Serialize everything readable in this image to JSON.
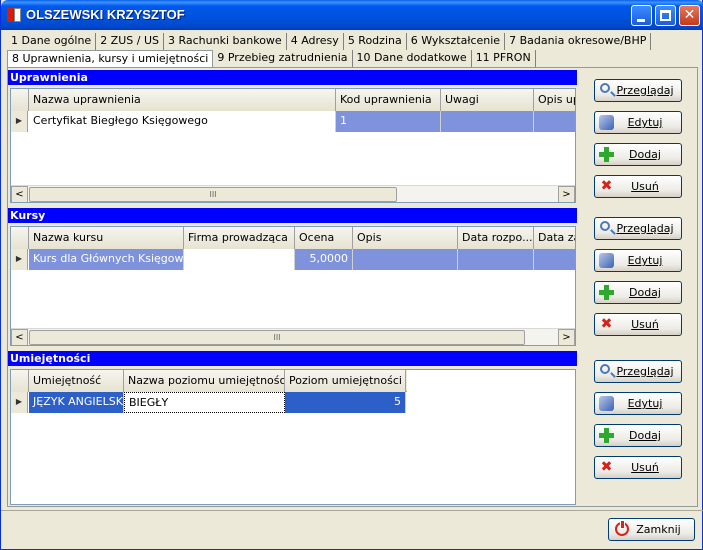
{
  "window": {
    "title": "OLSZEWSKI KRZYSZTOF"
  },
  "tabs_row1": [
    "1 Dane ogólne",
    "2 ZUS / US",
    "3 Rachunki bankowe",
    "4 Adresy",
    "5 Rodzina",
    "6 Wykształcenie",
    "7 Badania okresowe/BHP"
  ],
  "tabs_row2": [
    "8 Uprawnienia, kursy i umiejętności",
    "9 Przebieg zatrudnienia",
    "10 Dane dodatkowe",
    "11 PFRON"
  ],
  "uprawnienia": {
    "header": "Uprawnienia",
    "columns": [
      "Nazwa uprawnienia",
      "Kod uprawnienia",
      "Uwagi",
      "Opis up"
    ],
    "rows": [
      [
        "Certyfikat Biegłego Księgowego",
        "1",
        "",
        ""
      ]
    ]
  },
  "kursy": {
    "header": "Kursy",
    "columns": [
      "Nazwa kursu",
      "Firma prowadząca",
      "Ocena",
      "Opis",
      "Data rozpo...",
      "Data za"
    ],
    "rows": [
      [
        "Kurs dla Głównych Księgowych",
        "",
        "5,0000",
        "",
        "",
        ""
      ]
    ]
  },
  "umiejetnosci": {
    "header": "Umiejętności",
    "columns": [
      "Umiejętność",
      "Nazwa poziomu umiejętności",
      "Poziom umiejętności"
    ],
    "rows": [
      [
        "JĘZYK ANGIELSKI",
        "BIEGŁY",
        "5"
      ]
    ]
  },
  "actions": {
    "view": "Przeglądaj",
    "edit": "Edytuj",
    "add": "Dodaj",
    "delete": "Usuń"
  },
  "footer": {
    "close": "Zamknij"
  },
  "scroll": {
    "thumb": "III",
    "left": "<",
    "right": ">"
  },
  "icons": [
    "app-icon",
    "minimize-icon",
    "maximize-icon",
    "close-icon",
    "magnifier-icon",
    "edit-icon",
    "add-icon",
    "delete-icon",
    "power-icon"
  ]
}
